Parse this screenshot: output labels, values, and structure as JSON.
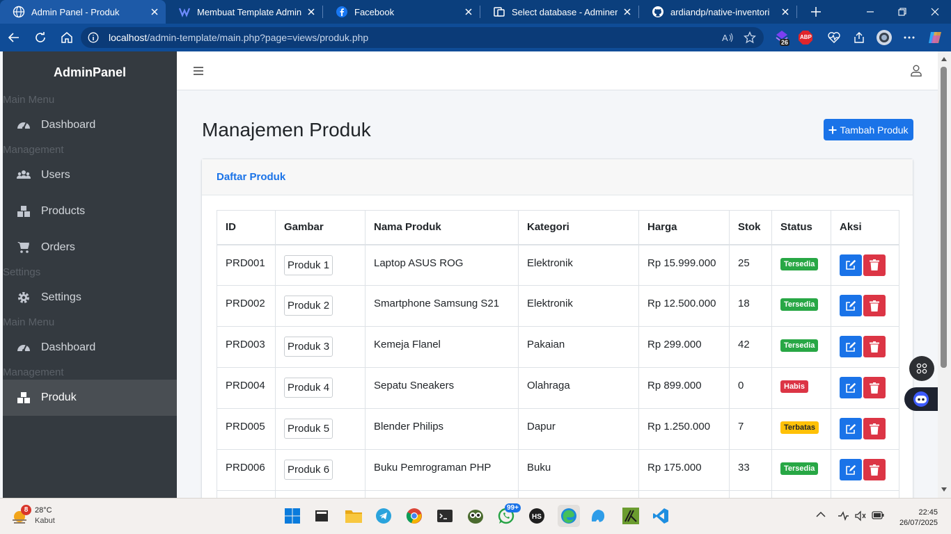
{
  "browser": {
    "tabs": [
      {
        "title": "Admin Panel - Produk",
        "active": true
      },
      {
        "title": "Membuat Template Admin PHP",
        "active": false
      },
      {
        "title": "Facebook",
        "active": false
      },
      {
        "title": "Select database - Adminer",
        "active": false
      },
      {
        "title": "ardiandp/native-inventori",
        "active": false
      }
    ],
    "url_host": "localhost",
    "url_path": "/admin-template/main.php?page=views/produk.php",
    "extension_badge": "26",
    "abp_label": "ABP"
  },
  "sidebar": {
    "brand": "AdminPanel",
    "headers": [
      "Main Menu",
      "Management",
      "Settings",
      "Main Menu",
      "Management"
    ],
    "items": [
      {
        "label": "Dashboard",
        "icon": "dashboard-icon"
      },
      {
        "label": "Users",
        "icon": "users-icon"
      },
      {
        "label": "Products",
        "icon": "boxes-icon"
      },
      {
        "label": "Orders",
        "icon": "cart-icon"
      },
      {
        "label": "Settings",
        "icon": "gear-icon"
      },
      {
        "label": "Dashboard",
        "icon": "dashboard-icon"
      },
      {
        "label": "Produk",
        "icon": "boxes-icon",
        "active": true
      }
    ]
  },
  "main": {
    "title": "Manajemen Produk",
    "add_button": "Tambah Produk",
    "card_title": "Daftar Produk",
    "columns": [
      "ID",
      "Gambar",
      "Nama Produk",
      "Kategori",
      "Harga",
      "Stok",
      "Status",
      "Aksi"
    ],
    "rows": [
      {
        "id": "PRD001",
        "image_alt": "Produk 1",
        "name": "Laptop ASUS ROG",
        "category": "Elektronik",
        "price": "Rp 15.999.000",
        "stock": "25",
        "status": "Tersedia",
        "status_type": "ok"
      },
      {
        "id": "PRD002",
        "image_alt": "Produk 2",
        "name": "Smartphone Samsung S21",
        "category": "Elektronik",
        "price": "Rp 12.500.000",
        "stock": "18",
        "status": "Tersedia",
        "status_type": "ok"
      },
      {
        "id": "PRD003",
        "image_alt": "Produk 3",
        "name": "Kemeja Flanel",
        "category": "Pakaian",
        "price": "Rp 299.000",
        "stock": "42",
        "status": "Tersedia",
        "status_type": "ok"
      },
      {
        "id": "PRD004",
        "image_alt": "Produk 4",
        "name": "Sepatu Sneakers",
        "category": "Olahraga",
        "price": "Rp 899.000",
        "stock": "0",
        "status": "Habis",
        "status_type": "out"
      },
      {
        "id": "PRD005",
        "image_alt": "Produk 5",
        "name": "Blender Philips",
        "category": "Dapur",
        "price": "Rp 1.250.000",
        "stock": "7",
        "status": "Terbatas",
        "status_type": "low"
      },
      {
        "id": "PRD006",
        "image_alt": "Produk 6",
        "name": "Buku Pemrograman PHP",
        "category": "Buku",
        "price": "Rp 175.000",
        "stock": "33",
        "status": "Tersedia",
        "status_type": "ok"
      }
    ]
  },
  "taskbar": {
    "weather_badge": "8",
    "temperature": "28°C",
    "condition": "Kabut",
    "whatsapp_badge": "99+",
    "time": "22:45",
    "date": "26/07/2025"
  },
  "colors": {
    "primary": "#1a73e8",
    "success": "#28a745",
    "danger": "#dc3545",
    "warning": "#ffc107",
    "sidebar_bg": "#343a40"
  }
}
